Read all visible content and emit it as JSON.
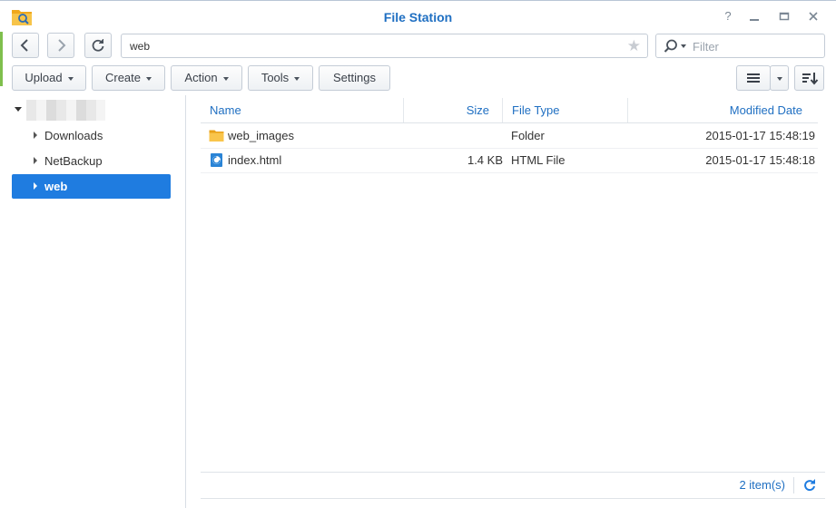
{
  "window": {
    "title": "File Station",
    "controls": [
      "help-icon",
      "minimize-icon",
      "maximize-icon",
      "close-icon"
    ],
    "accent": "#1f6fc2",
    "selection_color": "#1f7ce0"
  },
  "nav": {
    "path": "web",
    "filter_placeholder": "Filter"
  },
  "toolbar": {
    "upload": "Upload",
    "create": "Create",
    "action": "Action",
    "tools": "Tools",
    "settings": "Settings"
  },
  "tree": {
    "items": [
      {
        "label": "Downloads",
        "selected": false
      },
      {
        "label": "NetBackup",
        "selected": false
      },
      {
        "label": "web",
        "selected": true
      }
    ]
  },
  "grid": {
    "columns": {
      "name": "Name",
      "size": "Size",
      "type": "File Type",
      "modified": "Modified Date"
    },
    "rows": [
      {
        "name": "web_images",
        "size": "",
        "type": "Folder",
        "modified": "2015-01-17 15:48:19",
        "icon": "folder-icon"
      },
      {
        "name": "index.html",
        "size": "1.4 KB",
        "type": "HTML File",
        "modified": "2015-01-17 15:48:18",
        "icon": "html-file-icon"
      }
    ]
  },
  "status": {
    "count": "2 item(s)"
  }
}
